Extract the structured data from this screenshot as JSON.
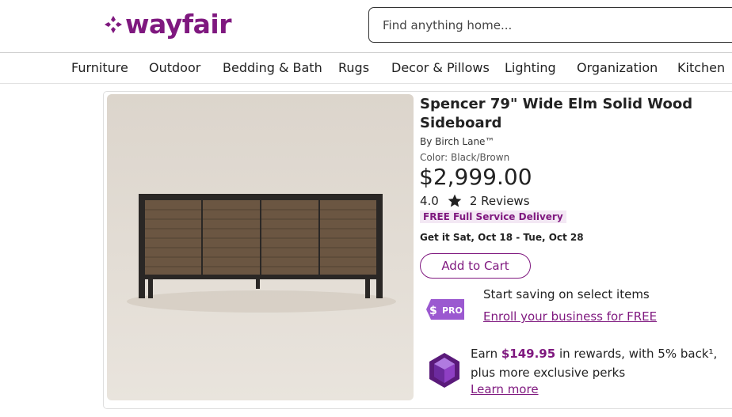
{
  "brand": {
    "name": "wayfair",
    "color": "#7f187f"
  },
  "search": {
    "placeholder": "Find anything home..."
  },
  "nav": {
    "items": [
      "Furniture",
      "Outdoor",
      "Bedding & Bath",
      "Rugs",
      "Decor & Pillows",
      "Lighting",
      "Organization",
      "Kitchen"
    ]
  },
  "product": {
    "title": "Spencer 79\" Wide Elm Solid Wood Sideboard",
    "by": "By Birch Lane™",
    "color_label": "Color:",
    "color_value": "Black/Brown",
    "price": "$2,999.00",
    "rating": "4.0",
    "reviews": "2 Reviews",
    "delivery_badge": "FREE Full Service Delivery",
    "eta": "Get it Sat, Oct 18 - Tue, Oct 28",
    "add_to_cart": "Add to Cart"
  },
  "pro": {
    "badge": "PRO",
    "text": "Start saving on select items",
    "link": "Enroll your business for FREE"
  },
  "rewards": {
    "prefix": "Earn ",
    "amount": "$149.95",
    "suffix": " in rewards, with 5% back¹, plus more exclusive perks",
    "link": "Learn more"
  }
}
